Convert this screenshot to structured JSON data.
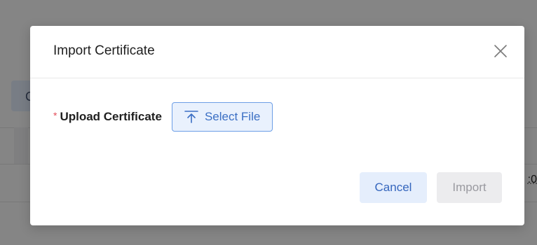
{
  "background": {
    "tab_fragment": "C",
    "right_fragment": ":0"
  },
  "dialog": {
    "title": "Import Certificate",
    "close_icon": "close-icon",
    "form": {
      "required_mark": "*",
      "upload_label": "Upload Certificate",
      "select_file_label": "Select File",
      "select_file_icon": "upload-icon"
    },
    "footer": {
      "cancel_label": "Cancel",
      "import_label": "Import",
      "import_disabled": true
    }
  },
  "colors": {
    "accent": "#3b6fc4",
    "required": "#e34d59"
  }
}
